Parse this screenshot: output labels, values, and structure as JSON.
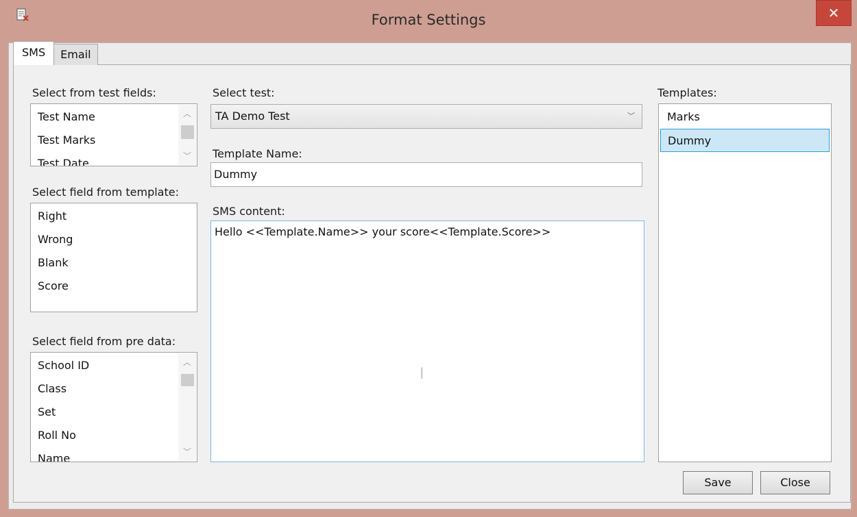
{
  "window": {
    "title": "Format Settings",
    "close_glyph": "✕"
  },
  "tabs": [
    {
      "label": "SMS"
    },
    {
      "label": "Email"
    }
  ],
  "test_fields": {
    "label": "Select from test fields:",
    "items": [
      "Test Name",
      "Test Marks",
      "Test Date"
    ]
  },
  "template_fields": {
    "label": "Select field from template:",
    "items": [
      "Right",
      "Wrong",
      "Blank",
      "Score"
    ]
  },
  "pre_data_fields": {
    "label": "Select field from pre data:",
    "items": [
      "School ID",
      "Class",
      "Set",
      "Roll No",
      "Name"
    ]
  },
  "select_test": {
    "label": "Select test:",
    "value": "TA Demo Test"
  },
  "template_name": {
    "label": "Template Name:",
    "value": "Dummy"
  },
  "sms_content": {
    "label": "SMS content:",
    "value": "Hello <<Template.Name>> your score<<Template.Score>>"
  },
  "templates": {
    "label": "Templates:",
    "items": [
      "Marks",
      "Dummy"
    ],
    "selected": "Dummy"
  },
  "buttons": {
    "save": "Save",
    "close": "Close"
  },
  "icons": {
    "app": "document-edit-icon",
    "close": "close-icon",
    "scroll_up": "chevron-up-icon",
    "scroll_down": "chevron-down-icon",
    "dropdown": "chevron-down-icon"
  }
}
